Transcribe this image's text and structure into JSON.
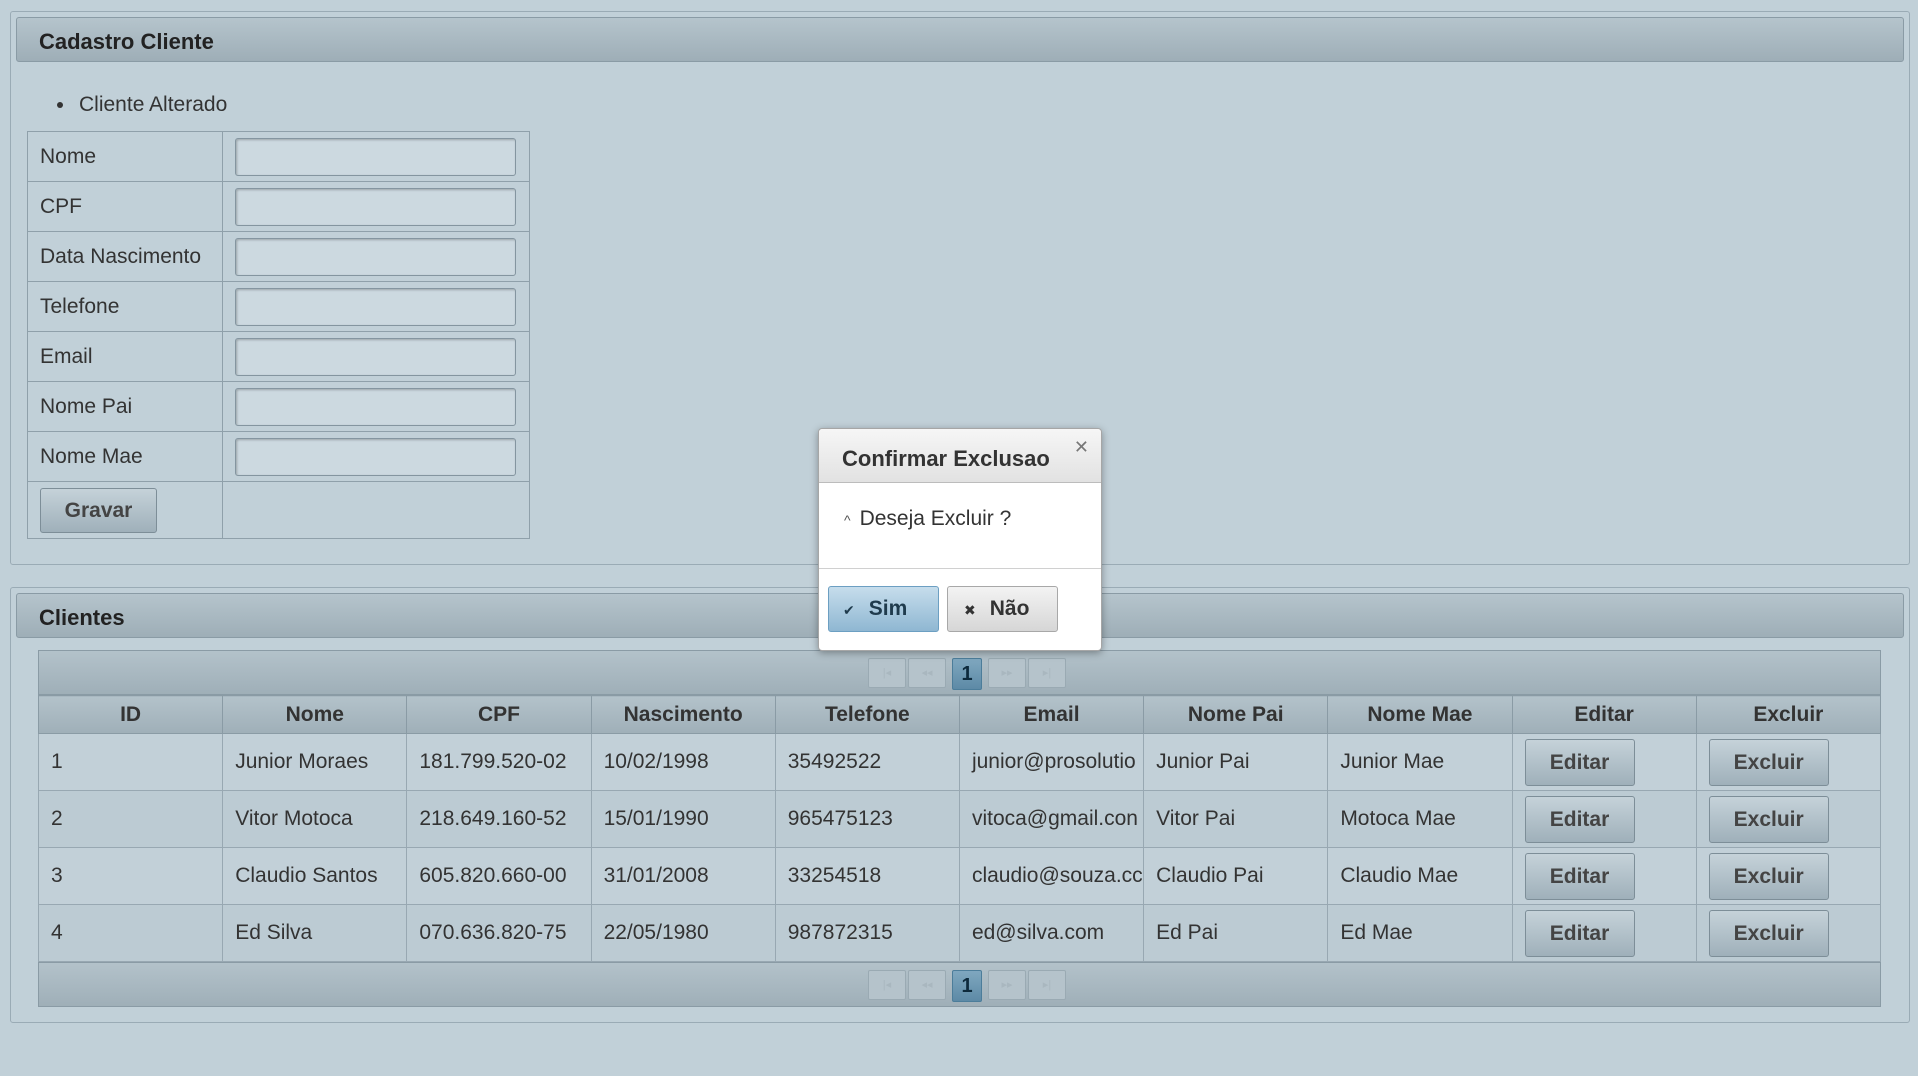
{
  "cadastro": {
    "title": "Cadastro Cliente",
    "message": "Cliente Alterado",
    "fields": [
      {
        "label": "Nome",
        "value": ""
      },
      {
        "label": "CPF",
        "value": ""
      },
      {
        "label": "Data Nascimento",
        "value": ""
      },
      {
        "label": "Telefone",
        "value": ""
      },
      {
        "label": "Email",
        "value": ""
      },
      {
        "label": "Nome Pai",
        "value": ""
      },
      {
        "label": "Nome Mae",
        "value": ""
      }
    ],
    "save_label": "Gravar"
  },
  "clientes": {
    "title": "Clientes",
    "paginator": {
      "current_page": "1",
      "first_icon": "first-page-icon",
      "prev_icon": "prev-page-icon",
      "next_icon": "next-page-icon",
      "last_icon": "last-page-icon"
    },
    "columns": [
      "ID",
      "Nome",
      "CPF",
      "Nascimento",
      "Telefone",
      "Email",
      "Nome Pai",
      "Nome Mae",
      "Editar",
      "Excluir"
    ],
    "rows": [
      {
        "id": "1",
        "nome": "Junior Moraes",
        "cpf": "181.799.520-02",
        "nascimento": "10/02/1998",
        "telefone": "35492522",
        "email": "junior@prosolutio",
        "nome_pai": "Junior Pai",
        "nome_mae": "Junior Mae",
        "editar": "Editar",
        "excluir": "Excluir"
      },
      {
        "id": "2",
        "nome": "Vitor Motoca",
        "cpf": "218.649.160-52",
        "nascimento": "15/01/1990",
        "telefone": "965475123",
        "email": "vitoca@gmail.con",
        "nome_pai": "Vitor Pai",
        "nome_mae": "Motoca Mae",
        "editar": "Editar",
        "excluir": "Excluir"
      },
      {
        "id": "3",
        "nome": "Claudio Santos",
        "cpf": "605.820.660-00",
        "nascimento": "31/01/2008",
        "telefone": "33254518",
        "email": "claudio@souza.cc",
        "nome_pai": "Claudio Pai",
        "nome_mae": "Claudio Mae",
        "editar": "Editar",
        "excluir": "Excluir"
      },
      {
        "id": "4",
        "nome": "Ed Silva",
        "cpf": "070.636.820-75",
        "nascimento": "22/05/1980",
        "telefone": "987872315",
        "email": "ed@silva.com",
        "nome_pai": "Ed Pai",
        "nome_mae": "Ed Mae",
        "editar": "Editar",
        "excluir": "Excluir"
      }
    ]
  },
  "dialog": {
    "title": "Confirmar Exclusao",
    "message": "Deseja Excluir ?",
    "yes_label": "Sim",
    "no_label": "Não",
    "close_icon": "close-icon",
    "yes_icon": "check-icon",
    "no_icon": "x-icon"
  },
  "colors": {
    "background": "#c1d0d8",
    "header": "#9eaeb7",
    "primary_button": "#8fb7d2",
    "page_active": "#5d8aa6"
  }
}
